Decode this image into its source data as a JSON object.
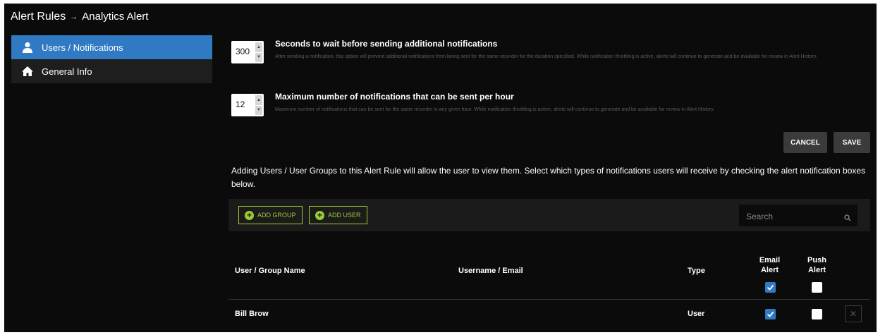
{
  "breadcrumb": {
    "parent": "Alert Rules",
    "separator": "→",
    "current": "Analytics Alert"
  },
  "sidebar": {
    "items": [
      {
        "label": "Users / Notifications",
        "icon": "user-icon",
        "active": true
      },
      {
        "label": "General Info",
        "icon": "home-icon",
        "active": false
      }
    ]
  },
  "settings": {
    "wait": {
      "value": "300",
      "title": "Seconds to wait before sending additional notifications",
      "description": "After sending a notification, this option will prevent additional notifications from being sent for the same recorder for the duration specified. While notification throttling is active, alerts will continue to generate and be available for review in Alert History."
    },
    "max": {
      "value": "12",
      "title": "Maximum number of notifications that can be sent per hour",
      "description": "Maximum number of notifications that can be sent for the same recorder in any given hour. While notification throttling is active, alerts will continue to generate and be available for review in Alert History."
    }
  },
  "actions": {
    "cancel": "CANCEL",
    "save": "SAVE"
  },
  "info_text": "Adding Users / User Groups to this Alert Rule will allow the user to view them. Select which types of notifications users will receive by checking the alert notification boxes below.",
  "toolbar": {
    "add_group": "ADD GROUP",
    "add_user": "ADD USER",
    "search_placeholder": "Search"
  },
  "table": {
    "headers": {
      "name": "User / Group Name",
      "username": "Username / Email",
      "type": "Type",
      "email_line1": "Email",
      "email_line2": "Alert",
      "push_line1": "Push",
      "push_line2": "Alert"
    },
    "header_email_all": true,
    "header_push_all": false,
    "rows": [
      {
        "name": "Bill Brow",
        "username": "",
        "type": "User",
        "email_alert": true,
        "push_alert": false
      }
    ]
  },
  "colors": {
    "accent": "#2f7ac2",
    "add_green": "#9acd32",
    "background": "#0b0b0b"
  }
}
